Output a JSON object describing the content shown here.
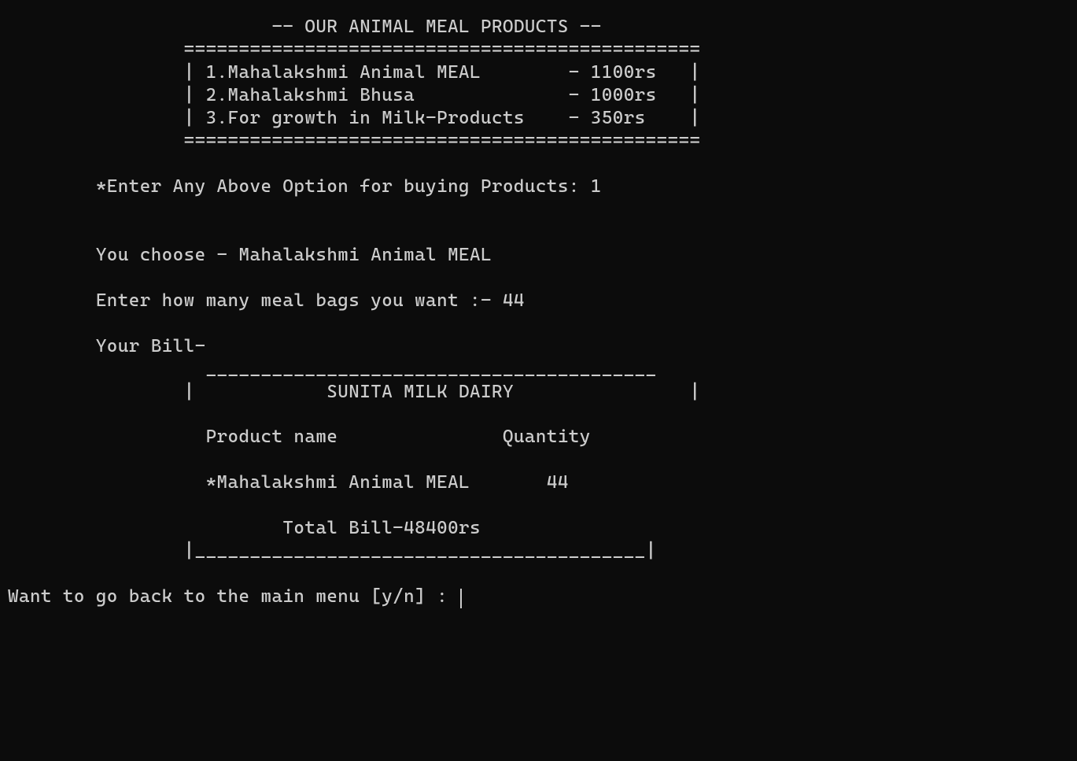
{
  "header": {
    "title": "                        -- OUR ANIMAL MEAL PRODUCTS --",
    "divider_top": "                ===============================================",
    "divider_bottom": "                ==============================================="
  },
  "products": {
    "rows": [
      "                | 1.Mahalakshmi Animal MEAL        - 1100rs   |",
      "                | 2.Mahalakshmi Bhusa              - 1000rs   |",
      "                | 3.For growth in Milk-Products    - 350rs    |"
    ]
  },
  "prompts": {
    "option_label": "        *Enter Any Above Option for buying Products: ",
    "quantity_label": "        Enter how many meal bags you want :- ",
    "mainmenu_label": "Want to go back to the main menu [y/n] : "
  },
  "inputs": {
    "option_value": "1",
    "quantity_value": "44"
  },
  "messages": {
    "choice": "        You choose - Mahalakshmi Animal MEAL"
  },
  "bill": {
    "heading": "        Your Bill-",
    "top_border": "                  _________________________________________",
    "company_line": "                |            SUNITA MILK DAIRY                |",
    "columns_line": "                  Product name               Quantity",
    "item_line": "                  *Mahalakshmi Animal MEAL       44",
    "total_line": "                         Total Bill-48400rs",
    "bottom_border": "                |_________________________________________|"
  }
}
